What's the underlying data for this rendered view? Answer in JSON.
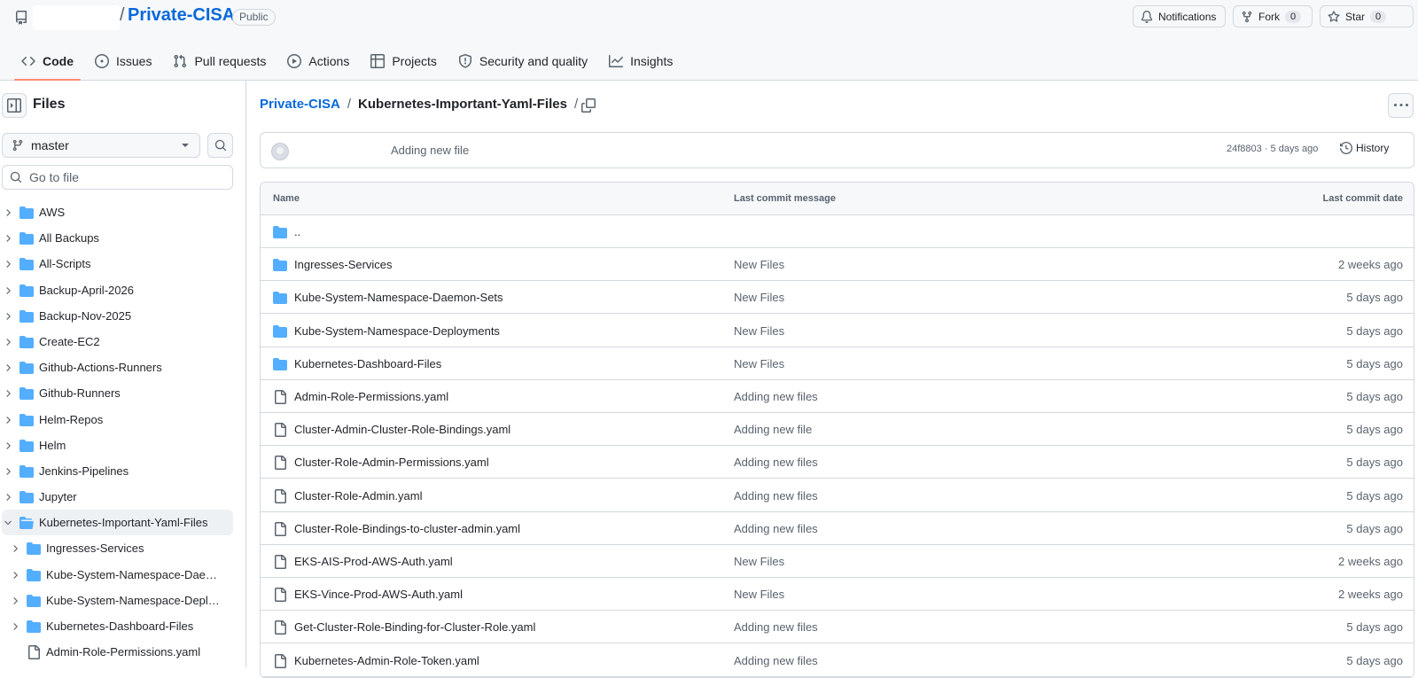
{
  "repo": {
    "name": "Private-CISA",
    "visibility": "Public"
  },
  "header_actions": {
    "notifications": "Notifications",
    "fork": "Fork",
    "fork_count": "0",
    "star": "Star",
    "star_count": "0"
  },
  "nav": [
    {
      "label": "Code",
      "icon": "code-icon",
      "active": true
    },
    {
      "label": "Issues",
      "icon": "issue-icon"
    },
    {
      "label": "Pull requests",
      "icon": "pull-request-icon"
    },
    {
      "label": "Actions",
      "icon": "play-icon"
    },
    {
      "label": "Projects",
      "icon": "table-icon"
    },
    {
      "label": "Security and quality",
      "icon": "shield-icon"
    },
    {
      "label": "Insights",
      "icon": "graph-icon"
    }
  ],
  "sidebar": {
    "title": "Files",
    "branch": "master",
    "goto_placeholder": "Go to file",
    "tree": [
      {
        "label": "AWS",
        "type": "folder",
        "depth": 0
      },
      {
        "label": "All Backups",
        "type": "folder",
        "depth": 0
      },
      {
        "label": "All-Scripts",
        "type": "folder",
        "depth": 0
      },
      {
        "label": "Backup-April-2026",
        "type": "folder",
        "depth": 0
      },
      {
        "label": "Backup-Nov-2025",
        "type": "folder",
        "depth": 0
      },
      {
        "label": "Create-EC2",
        "type": "folder",
        "depth": 0
      },
      {
        "label": "Github-Actions-Runners",
        "type": "folder",
        "depth": 0
      },
      {
        "label": "Github-Runners",
        "type": "folder",
        "depth": 0
      },
      {
        "label": "Helm-Repos",
        "type": "folder",
        "depth": 0
      },
      {
        "label": "Helm",
        "type": "folder",
        "depth": 0
      },
      {
        "label": "Jenkins-Pipelines",
        "type": "folder",
        "depth": 0
      },
      {
        "label": "Jupyter",
        "type": "folder",
        "depth": 0
      },
      {
        "label": "Kubernetes-Important-Yaml-Files",
        "type": "folder-open",
        "depth": 0,
        "selected": true
      },
      {
        "label": "Ingresses-Services",
        "type": "folder",
        "depth": 1
      },
      {
        "label": "Kube-System-Namespace-Daem…",
        "type": "folder",
        "depth": 1
      },
      {
        "label": "Kube-System-Namespace-Deplo…",
        "type": "folder",
        "depth": 1
      },
      {
        "label": "Kubernetes-Dashboard-Files",
        "type": "folder",
        "depth": 1
      },
      {
        "label": "Admin-Role-Permissions.yaml",
        "type": "file",
        "depth": 1
      }
    ]
  },
  "breadcrumb": {
    "root": "Private-CISA",
    "sep": "/",
    "current": "Kubernetes-Important-Yaml-Files",
    "trail": "/"
  },
  "latest_commit": {
    "message": "Adding new file",
    "meta": "24f8803 · 5 days ago",
    "history": "History"
  },
  "files_table": {
    "headers": [
      "Name",
      "Last commit message",
      "Last commit date"
    ],
    "rows": [
      {
        "name": "..",
        "type": "folder",
        "message": "",
        "date": ""
      },
      {
        "name": "Ingresses-Services",
        "type": "folder",
        "message": "New Files",
        "date": "2 weeks ago"
      },
      {
        "name": "Kube-System-Namespace-Daemon-Sets",
        "type": "folder",
        "message": "New Files",
        "date": "5 days ago"
      },
      {
        "name": "Kube-System-Namespace-Deployments",
        "type": "folder",
        "message": "New Files",
        "date": "5 days ago"
      },
      {
        "name": "Kubernetes-Dashboard-Files",
        "type": "folder",
        "message": "New Files",
        "date": "5 days ago"
      },
      {
        "name": "Admin-Role-Permissions.yaml",
        "type": "file",
        "message": "Adding new files",
        "date": "5 days ago"
      },
      {
        "name": "Cluster-Admin-Cluster-Role-Bindings.yaml",
        "type": "file",
        "message": "Adding new file",
        "date": "5 days ago"
      },
      {
        "name": "Cluster-Role-Admin-Permissions.yaml",
        "type": "file",
        "message": "Adding new files",
        "date": "5 days ago"
      },
      {
        "name": "Cluster-Role-Admin.yaml",
        "type": "file",
        "message": "Adding new files",
        "date": "5 days ago"
      },
      {
        "name": "Cluster-Role-Bindings-to-cluster-admin.yaml",
        "type": "file",
        "message": "Adding new files",
        "date": "5 days ago"
      },
      {
        "name": "EKS-AIS-Prod-AWS-Auth.yaml",
        "type": "file",
        "message": "New Files",
        "date": "2 weeks ago"
      },
      {
        "name": "EKS-Vince-Prod-AWS-Auth.yaml",
        "type": "file",
        "message": "New Files",
        "date": "2 weeks ago"
      },
      {
        "name": "Get-Cluster-Role-Binding-for-Cluster-Role.yaml",
        "type": "file",
        "message": "Adding new files",
        "date": "5 days ago"
      },
      {
        "name": "Kubernetes-Admin-Role-Token.yaml",
        "type": "file",
        "message": "Adding new files",
        "date": "5 days ago"
      }
    ]
  },
  "colors": {
    "link": "#0969da",
    "folder": "#54aeff",
    "active_tab": "#fd8c73"
  }
}
